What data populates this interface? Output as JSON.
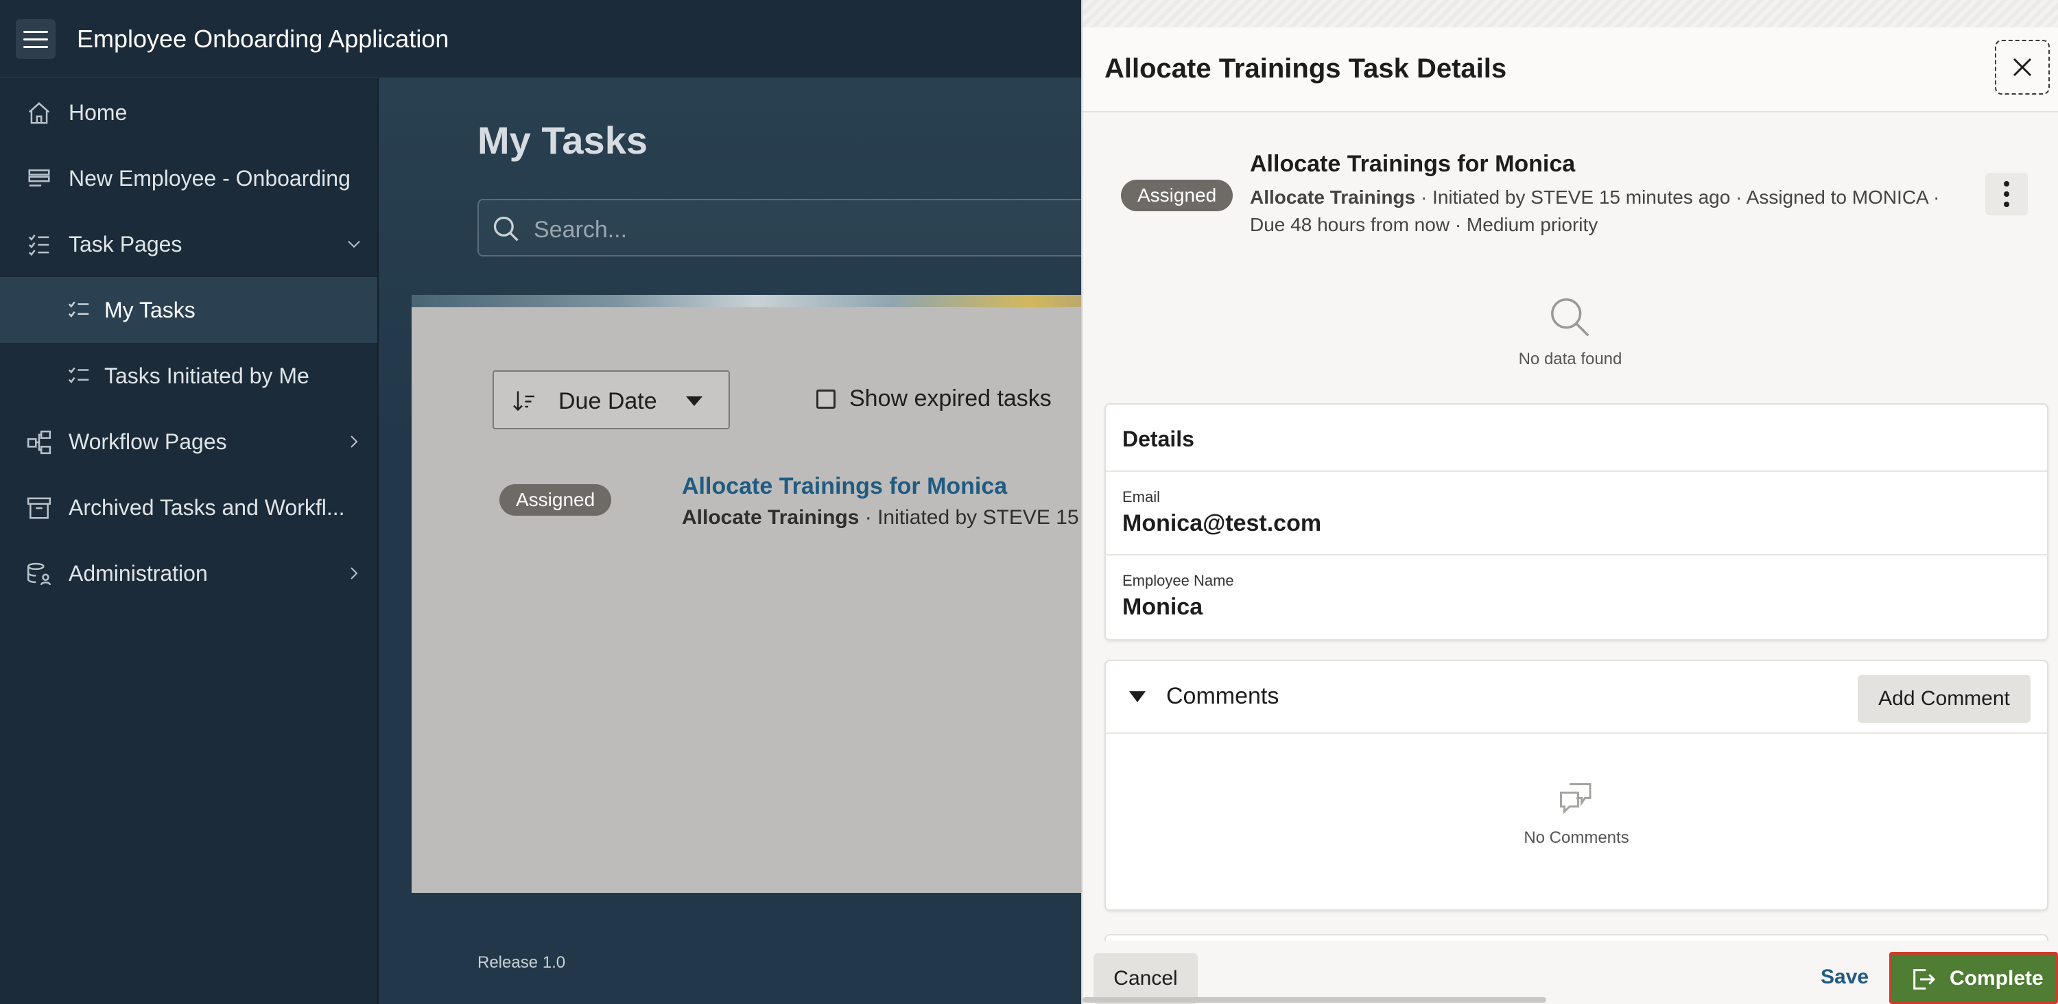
{
  "header": {
    "app_title": "Employee Onboarding Application"
  },
  "sidebar": {
    "items": [
      {
        "label": "Home",
        "icon": "home-icon"
      },
      {
        "label": "New Employee - Onboarding",
        "icon": "form-icon"
      },
      {
        "label": "Task Pages",
        "icon": "checklist-icon",
        "expanded": true
      },
      {
        "label": "My Tasks",
        "icon": "checklist-icon",
        "selected": true
      },
      {
        "label": "Tasks Initiated by Me",
        "icon": "checklist-icon"
      },
      {
        "label": "Workflow Pages",
        "icon": "workflow-icon"
      },
      {
        "label": "Archived Tasks and Workfl...",
        "icon": "archive-icon"
      },
      {
        "label": "Administration",
        "icon": "database-user-icon"
      }
    ]
  },
  "main": {
    "title": "My Tasks",
    "search_placeholder": "Search...",
    "sort_label": "Due Date",
    "show_expired_label": "Show expired tasks",
    "show_expired_checked": false,
    "task": {
      "badge": "Assigned",
      "title": "Allocate Trainings for Monica",
      "meta_bold": "Allocate Trainings",
      "meta_rest": " · Initiated by STEVE 15 minute"
    },
    "release": "Release 1.0"
  },
  "drawer": {
    "title": "Allocate Trainings Task Details",
    "task": {
      "badge": "Assigned",
      "title": "Allocate Trainings for Monica",
      "meta_bold": "Allocate Trainings",
      "meta_rest": " · Initiated by STEVE 15 minutes ago · Assigned to MONICA · Due 48 hours from now · Medium priority"
    },
    "no_data": "No data found",
    "details": {
      "title": "Details",
      "email_label": "Email",
      "email_value": "Monica@test.com",
      "name_label": "Employee Name",
      "name_value": "Monica"
    },
    "comments": {
      "title": "Comments",
      "add_label": "Add Comment",
      "empty": "No Comments"
    },
    "footer": {
      "cancel": "Cancel",
      "save": "Save",
      "complete": "Complete"
    }
  },
  "colors": {
    "header_bg": "#1c2b39",
    "selected_nav": "#2b4152",
    "badge": "#6e6a66",
    "link": "#1f5b82",
    "complete_bg": "#4f7d33",
    "complete_highlight": "#d23a2a"
  }
}
